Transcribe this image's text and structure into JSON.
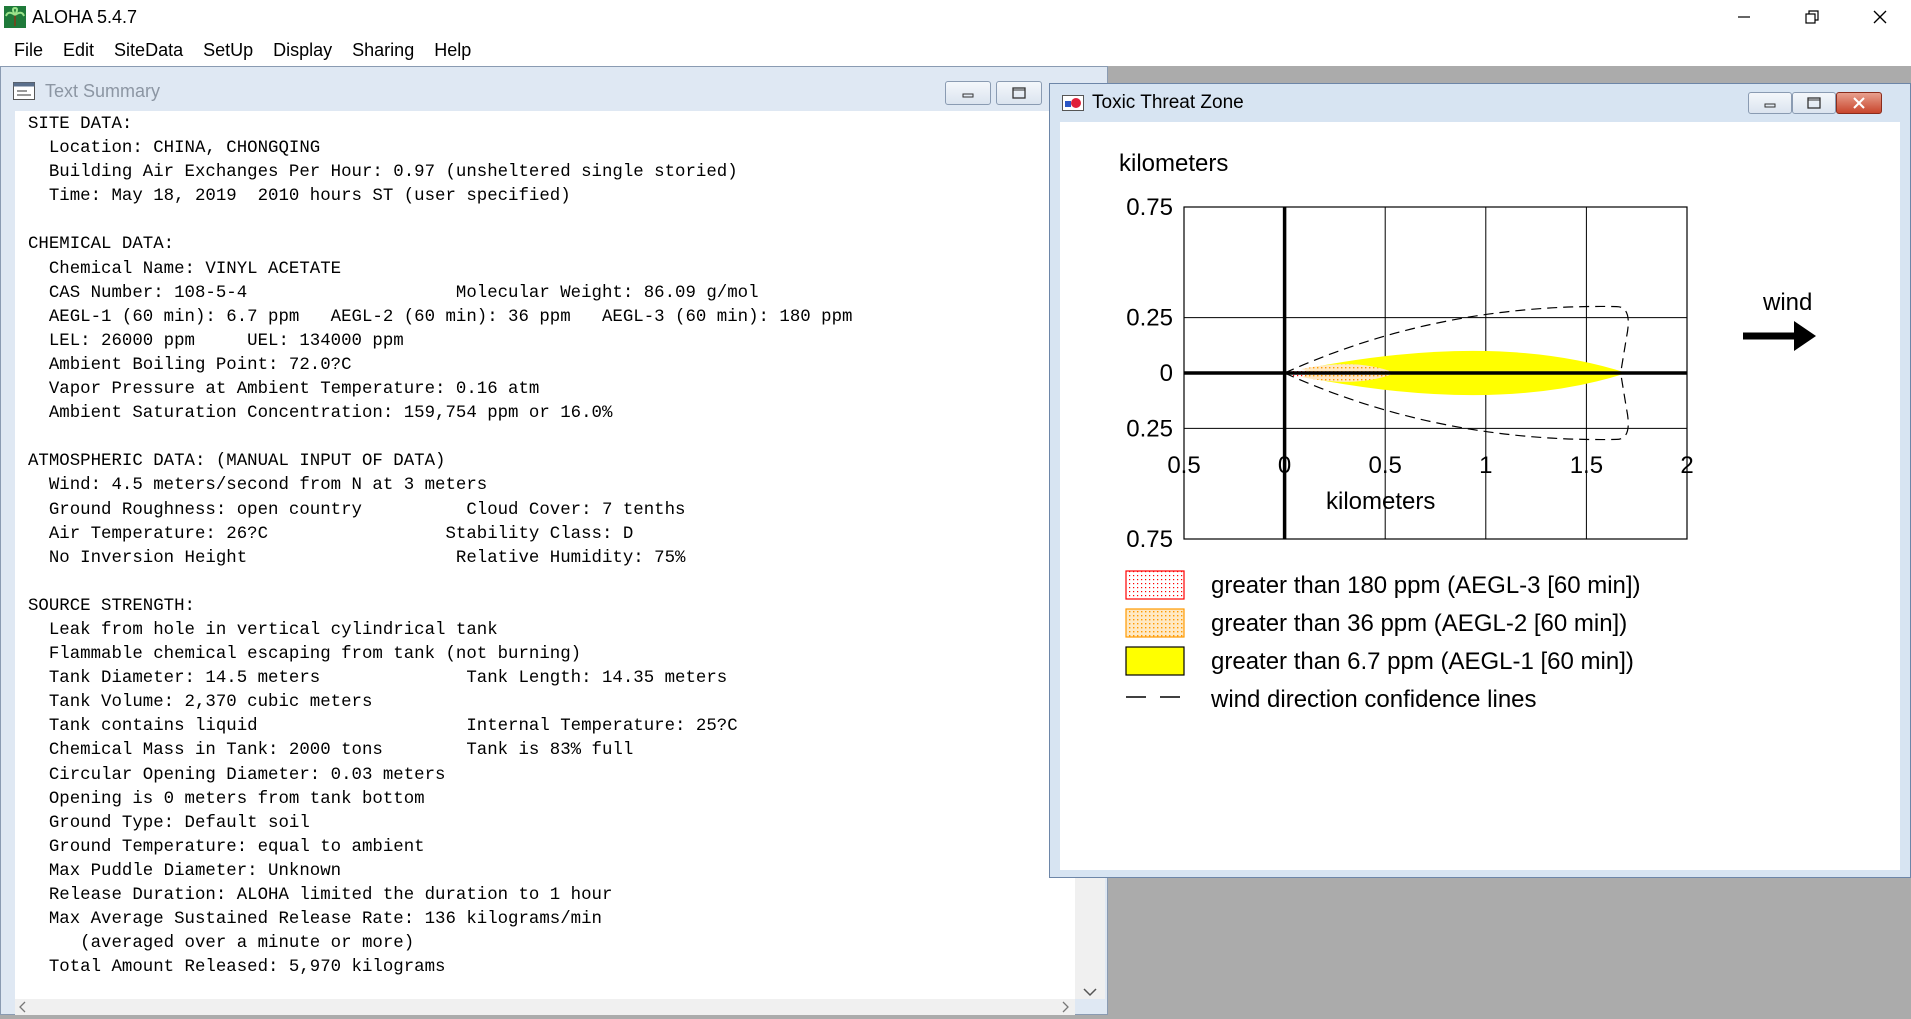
{
  "app": {
    "title": "ALOHA 5.4.7",
    "icon": "aloha-palm-tree-icon",
    "window_controls": [
      "minimize-icon",
      "restore-icon",
      "close-icon"
    ]
  },
  "menu": [
    "File",
    "Edit",
    "SiteData",
    "SetUp",
    "Display",
    "Sharing",
    "Help"
  ],
  "text_summary": {
    "title": "Text Summary",
    "lines": [
      "SITE DATA:",
      "  Location: CHINA, CHONGQING",
      "  Building Air Exchanges Per Hour: 0.97 (unsheltered single storied)",
      "  Time: May 18, 2019  2010 hours ST (user specified)",
      "",
      "CHEMICAL DATA:",
      "  Chemical Name: VINYL ACETATE",
      "  CAS Number: 108-5-4                    Molecular Weight: 86.09 g/mol",
      "  AEGL-1 (60 min): 6.7 ppm   AEGL-2 (60 min): 36 ppm   AEGL-3 (60 min): 180 ppm",
      "  LEL: 26000 ppm     UEL: 134000 ppm",
      "  Ambient Boiling Point: 72.0?C",
      "  Vapor Pressure at Ambient Temperature: 0.16 atm",
      "  Ambient Saturation Concentration: 159,754 ppm or 16.0%",
      "",
      "ATMOSPHERIC DATA: (MANUAL INPUT OF DATA)",
      "  Wind: 4.5 meters/second from N at 3 meters",
      "  Ground Roughness: open country          Cloud Cover: 7 tenths",
      "  Air Temperature: 26?C                 Stability Class: D",
      "  No Inversion Height                    Relative Humidity: 75%",
      "",
      "SOURCE STRENGTH:",
      "  Leak from hole in vertical cylindrical tank",
      "  Flammable chemical escaping from tank (not burning)",
      "  Tank Diameter: 14.5 meters              Tank Length: 14.35 meters",
      "  Tank Volume: 2,370 cubic meters",
      "  Tank contains liquid                    Internal Temperature: 25?C",
      "  Chemical Mass in Tank: 2000 tons        Tank is 83% full",
      "  Circular Opening Diameter: 0.03 meters",
      "  Opening is 0 meters from tank bottom",
      "  Ground Type: Default soil",
      "  Ground Temperature: equal to ambient",
      "  Max Puddle Diameter: Unknown",
      "  Release Duration: ALOHA limited the duration to 1 hour",
      "  Max Average Sustained Release Rate: 136 kilograms/min",
      "     (averaged over a minute or more)",
      "  Total Amount Released: 5,970 kilograms"
    ]
  },
  "threat_zone": {
    "title": "Toxic Threat Zone",
    "y_axis_label": "kilometers",
    "x_axis_label": "kilometers",
    "y_tick_labels": [
      "0.75",
      "0.25",
      "0",
      "0.25",
      "0.75"
    ],
    "x_tick_labels": [
      "0.5",
      "0",
      "0.5",
      "1",
      "1.5",
      "2"
    ],
    "wind_label": "wind",
    "legend": [
      {
        "label": "greater than 180 ppm (AEGL-3 [60 min])",
        "swatch": "red-dotted",
        "color": "#ff0000"
      },
      {
        "label": "greater than 36 ppm (AEGL-2 [60 min])",
        "swatch": "orange-dotted",
        "color": "#ff9900"
      },
      {
        "label": "greater than 6.7 ppm (AEGL-1 [60 min])",
        "swatch": "yellow-solid",
        "color": "#ffff00"
      },
      {
        "label": "wind direction confidence lines",
        "swatch": "dashed-line",
        "color": "#000000"
      }
    ]
  },
  "chart_data": {
    "type": "area",
    "xlabel": "kilometers",
    "ylabel": "kilometers",
    "xlim": [
      -0.5,
      2
    ],
    "ylim": [
      -0.75,
      0.75
    ],
    "x_ticks": [
      -0.5,
      0,
      0.5,
      1,
      1.5,
      2
    ],
    "y_ticks": [
      -0.75,
      -0.25,
      0,
      0.25,
      0.75
    ],
    "grid": true,
    "zones": [
      {
        "name": "greater than 180 ppm (AEGL-3 [60 min])",
        "start_km": 0,
        "end_km": 0.12,
        "max_halfwidth_km": 0.02,
        "color": "#ff0000"
      },
      {
        "name": "greater than 36 ppm (AEGL-2 [60 min])",
        "start_km": 0,
        "end_km": 0.55,
        "max_halfwidth_km": 0.04,
        "color": "#ff9900"
      },
      {
        "name": "greater than 6.7 ppm (AEGL-1 [60 min])",
        "start_km": 0,
        "end_km": 1.7,
        "max_halfwidth_km": 0.1,
        "color": "#ffff00"
      }
    ],
    "confidence_lines": {
      "end_km": 1.7,
      "max_halfwidth_km": 0.3
    }
  }
}
